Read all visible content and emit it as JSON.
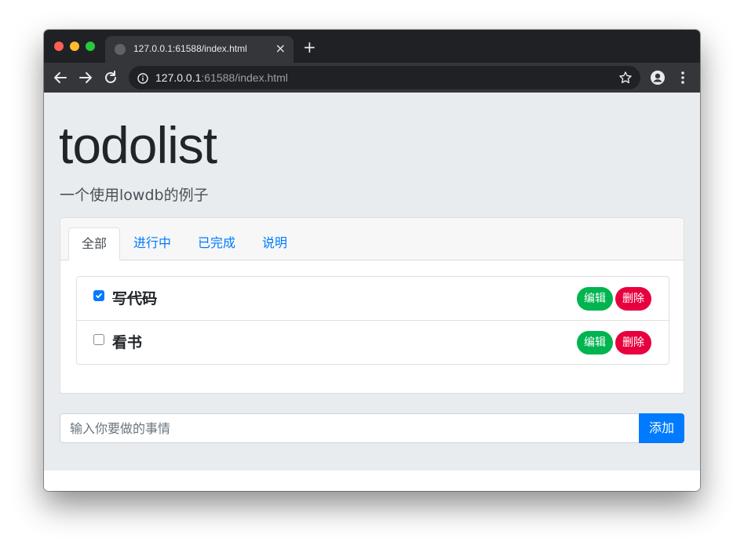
{
  "browser": {
    "tab_title": "127.0.0.1:61588/index.html",
    "tab_close": "×",
    "new_tab": "+",
    "url_host": "127.0.0.1",
    "url_port": ":61588",
    "url_path": "/index.html",
    "icons": [
      "back-icon",
      "forward-icon",
      "reload-icon",
      "info-icon",
      "star-icon",
      "profile-icon",
      "menu-icon",
      "globe-icon"
    ]
  },
  "page": {
    "title": "todolist",
    "subtitle": "一个使用lowdb的例子"
  },
  "tabs": [
    {
      "label": "全部",
      "active": true
    },
    {
      "label": "进行中",
      "active": false
    },
    {
      "label": "已完成",
      "active": false
    },
    {
      "label": "说明",
      "active": false
    }
  ],
  "todos": [
    {
      "text": "写代码",
      "done": true,
      "edit_label": "编辑",
      "delete_label": "删除"
    },
    {
      "text": "看书",
      "done": false,
      "edit_label": "编辑",
      "delete_label": "删除"
    }
  ],
  "form": {
    "placeholder": "输入你要做的事情",
    "value": "",
    "add_label": "添加"
  },
  "colors": {
    "primary": "#007bff",
    "edit": "#00b44f",
    "delete": "#e8003e",
    "jumbotron": "#e9ecef"
  }
}
